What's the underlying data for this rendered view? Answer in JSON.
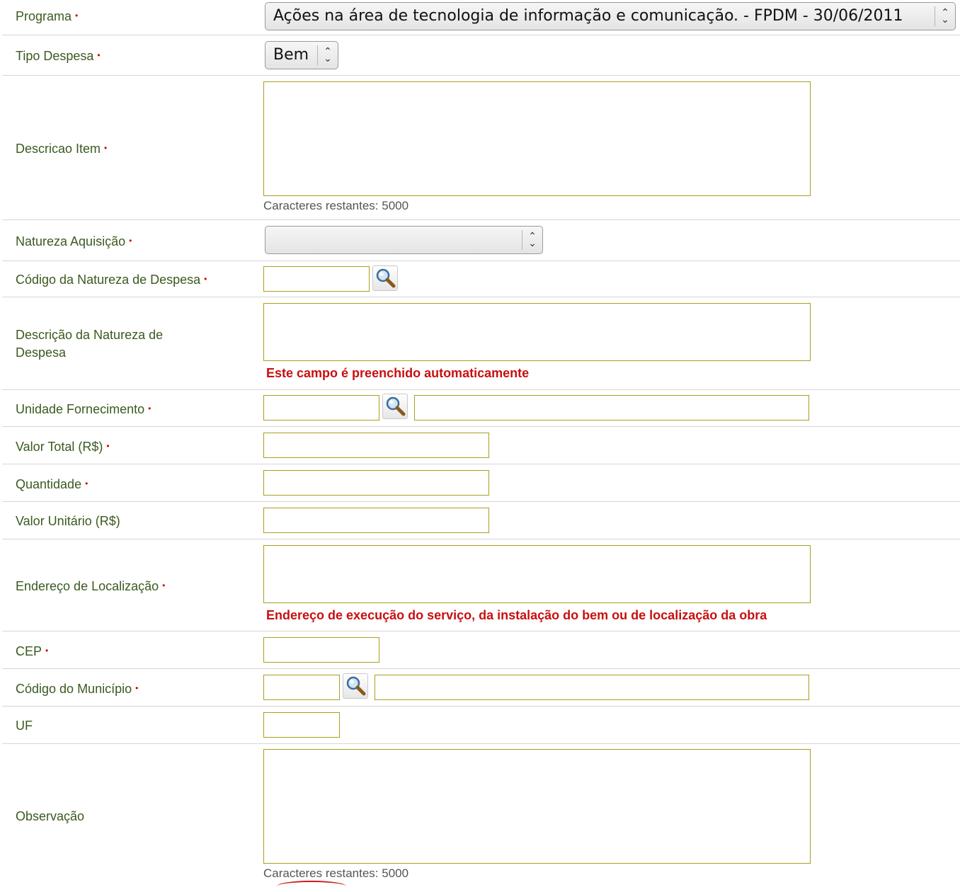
{
  "form": {
    "required_marker": "•",
    "fields": {
      "programa": {
        "label": "Programa",
        "selected": "Ações na área de tecnologia de informação e comunicação. - FPDM - 30/06/2011"
      },
      "tipo_despesa": {
        "label": "Tipo Despesa",
        "selected": "Bem"
      },
      "descricao_item": {
        "label": "Descricao Item",
        "value": "",
        "counter": "Caracteres restantes: 5000"
      },
      "natureza_aquisicao": {
        "label": "Natureza Aquisição",
        "selected": ""
      },
      "codigo_natureza_despesa": {
        "label": "Código da Natureza de Despesa",
        "value": "",
        "icon": "magnifier-icon"
      },
      "descricao_natureza_despesa": {
        "label_line1": "Descrição da Natureza de",
        "label_line2": "Despesa",
        "value": "",
        "note": "Este campo é preenchido automaticamente"
      },
      "unidade_fornecimento": {
        "label": "Unidade Fornecimento",
        "code": "",
        "description": "",
        "icon": "magnifier-icon"
      },
      "valor_total": {
        "label": "Valor Total (R$)",
        "value": ""
      },
      "quantidade": {
        "label": "Quantidade",
        "value": ""
      },
      "valor_unitario": {
        "label": "Valor Unitário (R$)",
        "value": ""
      },
      "endereco_localizacao": {
        "label": "Endereço de Localização",
        "value": "",
        "note": "Endereço de execução do serviço, da instalação do bem ou de localização da obra"
      },
      "cep": {
        "label": "CEP",
        "value": ""
      },
      "codigo_municipio": {
        "label": "Código do Município",
        "code": "",
        "name": "",
        "icon": "magnifier-icon"
      },
      "uf": {
        "label": "UF",
        "value": ""
      },
      "observacao": {
        "label": "Observação",
        "value": "",
        "counter": "Caracteres restantes: 5000"
      }
    }
  },
  "colors": {
    "label": "#3a5a1e",
    "required": "#d40000",
    "field_border": "#a8a020",
    "note": "#c81010",
    "divider": "#d6d6d6"
  }
}
